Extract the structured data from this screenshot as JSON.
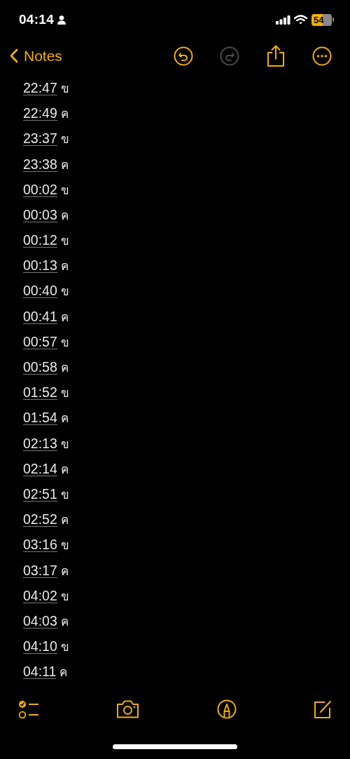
{
  "status_bar": {
    "time": "04:14",
    "battery": "54"
  },
  "nav": {
    "back_label": "Notes",
    "actions": [
      {
        "kind": "undo",
        "disabled": false
      },
      {
        "kind": "redo",
        "disabled": true
      },
      {
        "kind": "share",
        "disabled": false
      },
      {
        "kind": "more",
        "disabled": false
      }
    ]
  },
  "note": {
    "lines": [
      {
        "time": "22:47",
        "suffix": "ข"
      },
      {
        "time": "22:49",
        "suffix": "ค"
      },
      {
        "time": "23:37",
        "suffix": "ข"
      },
      {
        "time": "23:38",
        "suffix": "ค"
      },
      {
        "time": "00:02",
        "suffix": "ข"
      },
      {
        "time": "00:03",
        "suffix": "ค"
      },
      {
        "time": "00:12",
        "suffix": "ข"
      },
      {
        "time": "00:13",
        "suffix": "ค"
      },
      {
        "time": "00:40",
        "suffix": "ข"
      },
      {
        "time": "00:41",
        "suffix": "ค"
      },
      {
        "time": "00:57",
        "suffix": "ข"
      },
      {
        "time": "00:58",
        "suffix": "ค"
      },
      {
        "time": "01:52",
        "suffix": "ข"
      },
      {
        "time": "01:54",
        "suffix": "ค"
      },
      {
        "time": "02:13",
        "suffix": "ข"
      },
      {
        "time": "02:14",
        "suffix": "ค"
      },
      {
        "time": "02:51",
        "suffix": "ข"
      },
      {
        "time": "02:52",
        "suffix": "ค"
      },
      {
        "time": "03:16",
        "suffix": "ข"
      },
      {
        "time": "03:17",
        "suffix": "ค"
      },
      {
        "time": "04:02",
        "suffix": "ข"
      },
      {
        "time": "04:03",
        "suffix": "ค"
      },
      {
        "time": "04:10",
        "suffix": "ข"
      },
      {
        "time": "04:11",
        "suffix": "ค"
      }
    ]
  },
  "toolbar": [
    {
      "kind": "checklist"
    },
    {
      "kind": "camera"
    },
    {
      "kind": "markup"
    },
    {
      "kind": "compose"
    }
  ]
}
